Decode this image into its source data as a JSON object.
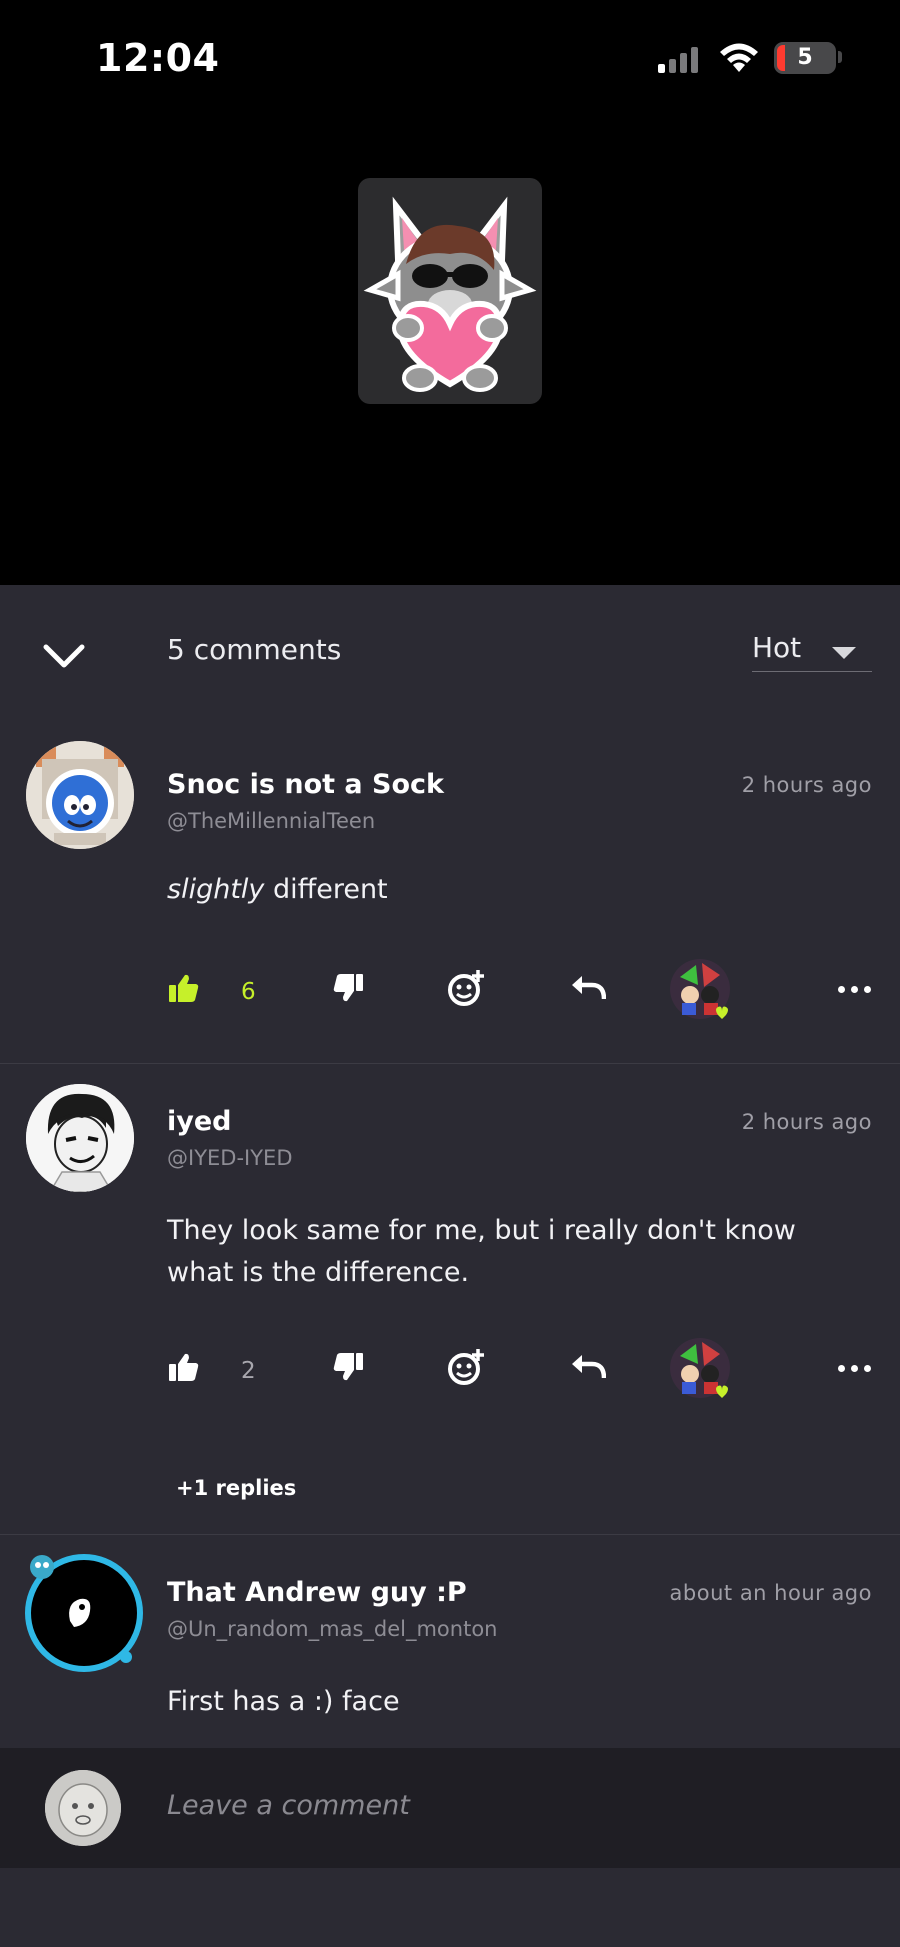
{
  "status_bar": {
    "time": "12:04",
    "battery": "5"
  },
  "header": {
    "comment_count": "5 comments",
    "sort": "Hot"
  },
  "comments": [
    {
      "name": "Snoc is not a Sock",
      "handle": "@TheMillennialTeen",
      "time": "2 hours ago",
      "body_em": "slightly",
      "body_rest": " different",
      "likes": "6",
      "liked": true
    },
    {
      "name": "iyed",
      "handle": "@IYED-IYED",
      "time": "2 hours ago",
      "body": "They look same for me, but i really don't know what is the difference.",
      "likes": "2",
      "liked": false,
      "replies": "+1 replies"
    },
    {
      "name": "That Andrew guy :P",
      "handle": "@Un_random_mas_del_monton",
      "time": "about an hour ago",
      "body": "First has a :) face"
    }
  ],
  "composer": {
    "placeholder": "Leave a comment"
  },
  "colors": {
    "accent_like": "#c6f02a",
    "background": "#2b2a33",
    "composer_bg": "#1f1e24"
  }
}
